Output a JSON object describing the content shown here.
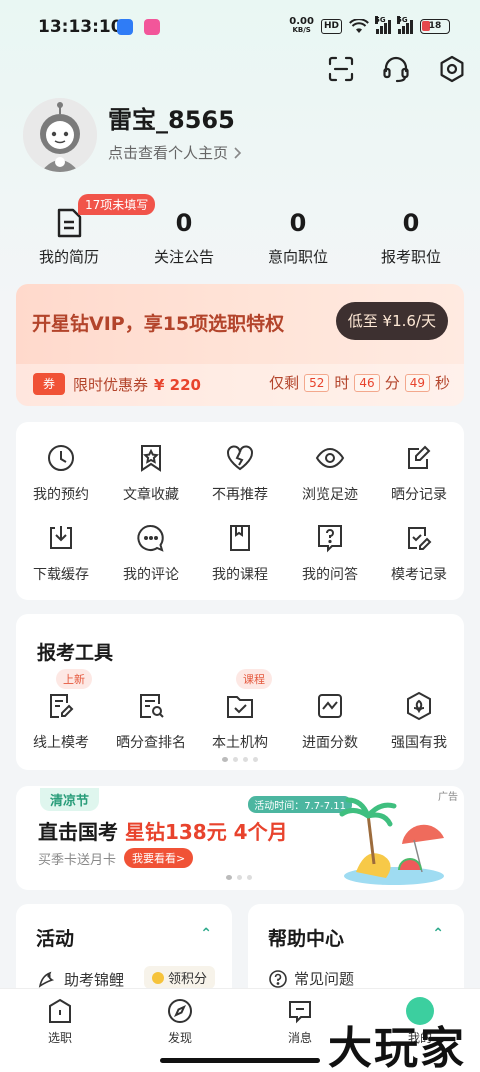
{
  "status_bar": {
    "time": "13:13:10",
    "speed_value": "0.00",
    "speed_unit": "KB/S",
    "hd": "HD",
    "signal1": "5G",
    "signal2": "5G",
    "battery": "18"
  },
  "profile": {
    "username": "雷宝_8565",
    "link": "点击查看个人主页"
  },
  "stats": {
    "resume_badge": "17项未填写",
    "resume_label": "我的简历",
    "follow_num": "0",
    "follow_label": "关注公告",
    "intent_num": "0",
    "intent_label": "意向职位",
    "apply_num": "0",
    "apply_label": "报考职位"
  },
  "vip": {
    "title": "开星钻VIP，享15项选职特权",
    "button": "低至 ¥1.6/天",
    "coupon_tag": "券",
    "coupon_text": "限时优惠券",
    "coupon_price": "¥ 220",
    "remain": "仅剩",
    "h": "52",
    "h_unit": "时",
    "m": "46",
    "m_unit": "分",
    "s": "49",
    "s_unit": "秒"
  },
  "grid": {
    "items": [
      {
        "label": "我的预约"
      },
      {
        "label": "文章收藏"
      },
      {
        "label": "不再推荐"
      },
      {
        "label": "浏览足迹"
      },
      {
        "label": "晒分记录"
      },
      {
        "label": "下载缓存"
      },
      {
        "label": "我的评论"
      },
      {
        "label": "我的课程"
      },
      {
        "label": "我的问答"
      },
      {
        "label": "模考记录"
      }
    ]
  },
  "tools": {
    "title": "报考工具",
    "badge_new": "上新",
    "badge_course": "课程",
    "items": [
      {
        "label": "线上模考"
      },
      {
        "label": "晒分查排名"
      },
      {
        "label": "本土机构"
      },
      {
        "label": "进面分数"
      },
      {
        "label": "强国有我"
      }
    ]
  },
  "banner": {
    "tag": "清凉节",
    "ad": "广告",
    "time": "活动时间：7.7-7.11",
    "main_a": "直击国考",
    "main_b": "星钻138元 4个月",
    "sub": "买季卡送月卡",
    "btn": "我要看看>"
  },
  "activity": {
    "title": "活动",
    "item": "助考锦鲤",
    "chip": "领积分"
  },
  "help": {
    "title": "帮助中心",
    "item": "常见问题"
  },
  "tabbar": {
    "t1": "选职",
    "t2": "发现",
    "t3": "消息",
    "t4": "我的"
  },
  "watermark": "大玩家",
  "colors": {
    "accent": "#2aa889",
    "vip_text": "#b3442b",
    "red": "#e8432d"
  }
}
